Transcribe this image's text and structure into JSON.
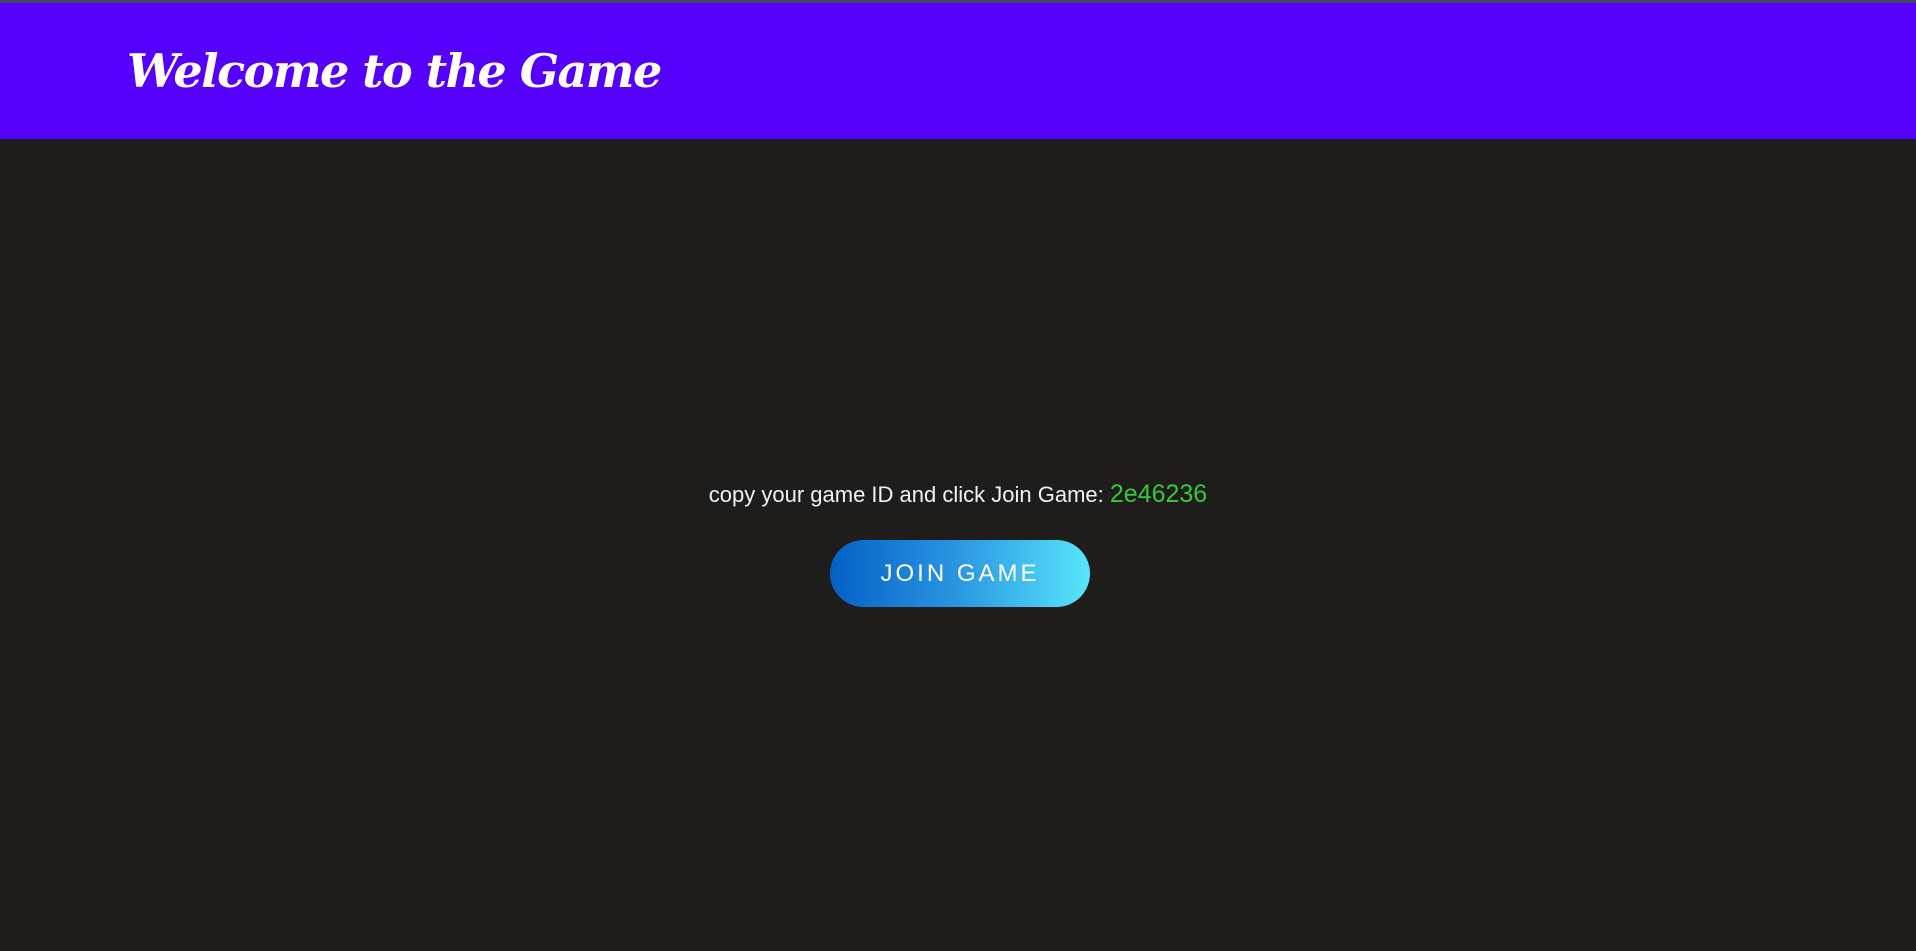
{
  "header": {
    "title": "Welcome to the Game",
    "background_color": "#5500fa"
  },
  "main": {
    "background_color": "#1e1d1c",
    "instruction": "copy your game ID and click Join Game:",
    "game_id": "2e46236",
    "game_id_color": "#35c93a",
    "join_button_label": "JOIN GAME"
  }
}
